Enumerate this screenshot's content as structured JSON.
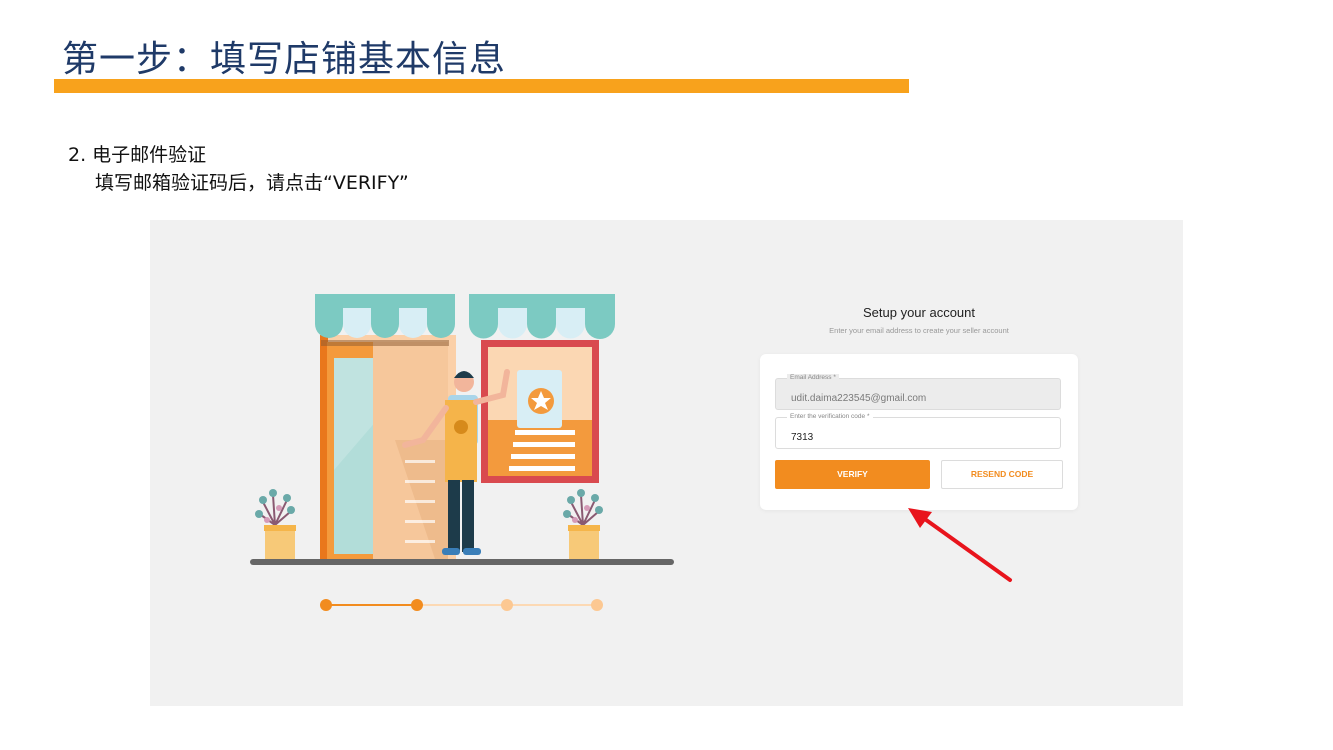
{
  "slide": {
    "title": "第一步：填写店铺基本信息",
    "step_heading": "2. 电子邮件验证",
    "step_instruction": "填写邮箱验证码后，请点击“VERIFY”",
    "accent_color": "#f8a21c",
    "title_color": "#1f3a68"
  },
  "setup": {
    "title": "Setup your account",
    "subtitle": "Enter your email address to create your seller account",
    "email_label": "Email Address *",
    "email_value": "udit.daima223545@gmail.com",
    "code_label": "Enter the verification code *",
    "code_value": "7313",
    "verify_label": "VERIFY",
    "resend_label": "RESEND CODE",
    "button_color": "#f28c1f"
  },
  "progress": {
    "total_steps": 4,
    "current_step": 2
  },
  "annotation": {
    "arrow_color": "#e8141c",
    "points_to": "verify-button"
  }
}
